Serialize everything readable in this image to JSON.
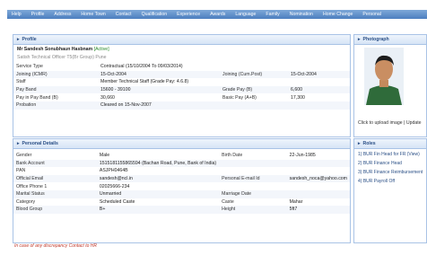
{
  "nav": [
    "Help",
    "Profile",
    "Address",
    "Home Town",
    "Contact",
    "Qualification",
    "Experience",
    "Awards",
    "Language",
    "Family",
    "Nomination",
    "Home Change",
    "Personal"
  ],
  "profile": {
    "title": "Profile",
    "name": "Mr Sandesh Sonubhaun Hasbnam",
    "status": "[Active]",
    "org": "Satish Technical Officer T5(Br Group) Pune",
    "rows": [
      {
        "l1": "Service Type",
        "v1": "Contractual (15/10/2004 To 09/03/2014)",
        "l2": "",
        "v2": ""
      },
      {
        "l1": "Joining (ICMR)",
        "v1": "15-Oct-2004",
        "l2": "Joining (Cum.Post)",
        "v2": "15-Oct-2004"
      },
      {
        "l1": "Staff",
        "v1": "Member Technical Staff (Grade Pay: 4.6.8)",
        "l2": "",
        "v2": ""
      },
      {
        "l1": "Pay Band",
        "v1": "15600 - 39100",
        "l2": "Grade Pay (B)",
        "v2": "6,600"
      },
      {
        "l1": "Pay in Pay Band (B)",
        "v1": "30,660",
        "l2": "Basic Pay (A+B)",
        "v2": "17,300"
      },
      {
        "l1": "Probation",
        "v1": "Cleared on 15-Nov-2007",
        "l2": "",
        "v2": ""
      }
    ]
  },
  "photograph": {
    "title": "Photograph",
    "caption": "Click to upload image | Update"
  },
  "personal": {
    "title": "Personal Details",
    "rows": [
      {
        "l1": "Gender",
        "v1": "Male",
        "l2": "Birth Date",
        "v2": "22-Jun-1985"
      },
      {
        "l1": "Bank Account",
        "v1": "1515181155865594 (Bachan Road, Pune, Bank of India)",
        "l2": "",
        "v2": ""
      },
      {
        "l1": "PAN",
        "v1": "ASJPH0464B",
        "l2": "",
        "v2": ""
      },
      {
        "l1": "Official Email",
        "v1": "sandesh@ncl.in",
        "l2": "Personal E-mail Id",
        "v2": "sandesh_noca@yahoo.com"
      },
      {
        "l1": "Office Phone 1",
        "v1": "02025666-234",
        "l2": "",
        "v2": ""
      },
      {
        "l1": "Marital Status",
        "v1": "Unmarried",
        "l2": "Marriage Date",
        "v2": ""
      },
      {
        "l1": "Category",
        "v1": "Scheduled Caste",
        "l2": "Caste",
        "v2": "Mahar"
      },
      {
        "l1": "Blood Group",
        "v1": "B+",
        "l2": "Height",
        "v2": "5ft7"
      }
    ]
  },
  "roles": {
    "title": "Roles",
    "items": [
      "1) BUR Fin Head for FR (View)",
      "2) BUR Finance Head",
      "3) BUR Finance Reimbursement",
      "4) BUR Payroll Off"
    ]
  },
  "footnote": "In case of any discrepancy Contact to HR"
}
